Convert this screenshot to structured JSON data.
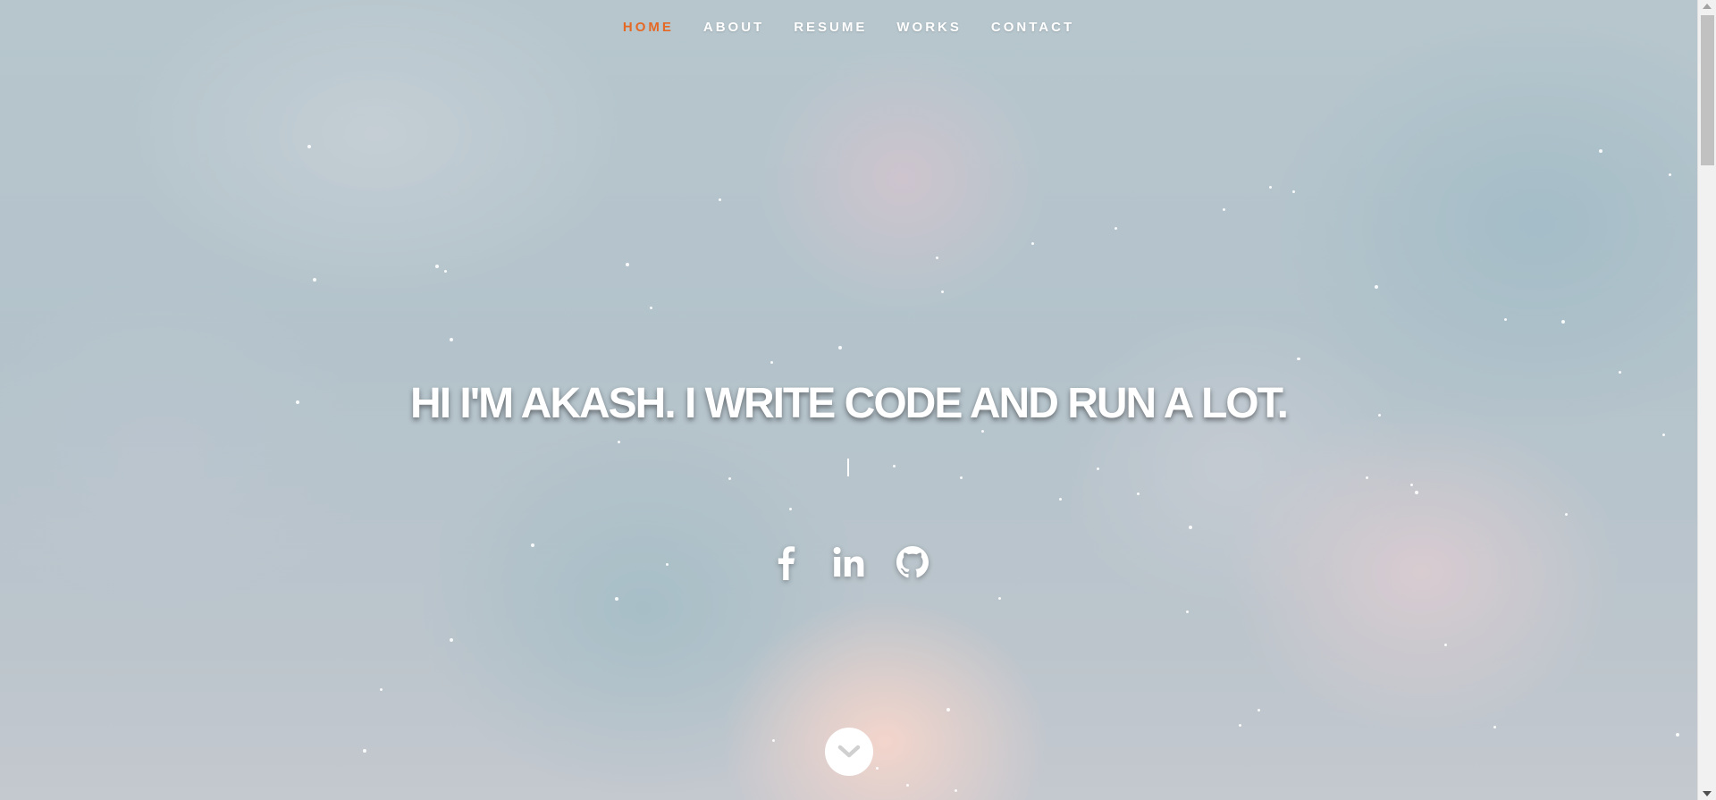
{
  "nav": {
    "items": [
      {
        "label": "HOME",
        "active": true
      },
      {
        "label": "ABOUT",
        "active": false
      },
      {
        "label": "RESUME",
        "active": false
      },
      {
        "label": "WORKS",
        "active": false
      },
      {
        "label": "CONTACT",
        "active": false
      }
    ]
  },
  "hero": {
    "headline": "HI I'M AKASH. I WRITE CODE AND RUN A LOT."
  },
  "social": {
    "links": [
      {
        "icon": "facebook-icon"
      },
      {
        "icon": "linkedin-icon"
      },
      {
        "icon": "github-icon"
      }
    ]
  },
  "scroll_down": {
    "icon": "chevron-down-icon"
  },
  "colors": {
    "accent": "#e56925",
    "text": "#ffffff",
    "chevron": "#d0d0d0"
  }
}
